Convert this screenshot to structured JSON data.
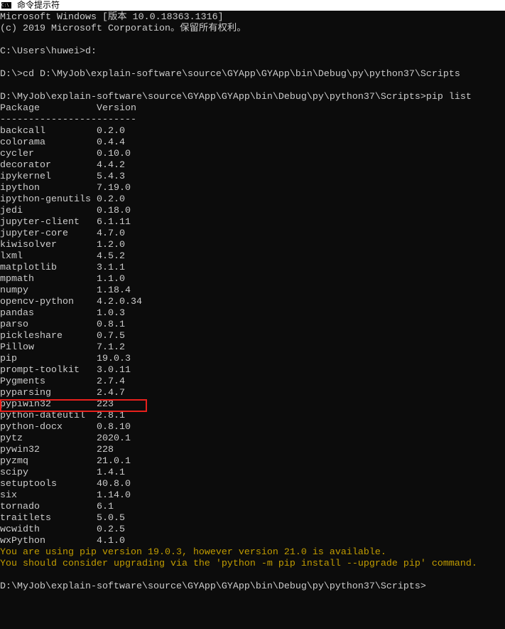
{
  "window": {
    "title": "命令提示符",
    "icon": "cmd-icon",
    "icon_text": "C:\\"
  },
  "header_lines": [
    "Microsoft Windows [版本 10.0.18363.1316]",
    "(c) 2019 Microsoft Corporation。保留所有权利。",
    "",
    "C:\\Users\\huwei>d:",
    "",
    "D:\\>cd D:\\MyJob\\explain-software\\source\\GYApp\\GYApp\\bin\\Debug\\py\\python37\\Scripts",
    "",
    "D:\\MyJob\\explain-software\\source\\GYApp\\GYApp\\bin\\Debug\\py\\python37\\Scripts>pip list"
  ],
  "table": {
    "headers": [
      "Package",
      "Version"
    ],
    "separator": [
      "-----------------",
      "-------"
    ],
    "rows": [
      [
        "backcall",
        "0.2.0"
      ],
      [
        "colorama",
        "0.4.4"
      ],
      [
        "cycler",
        "0.10.0"
      ],
      [
        "decorator",
        "4.4.2"
      ],
      [
        "ipykernel",
        "5.4.3"
      ],
      [
        "ipython",
        "7.19.0"
      ],
      [
        "ipython-genutils",
        "0.2.0"
      ],
      [
        "jedi",
        "0.18.0"
      ],
      [
        "jupyter-client",
        "6.1.11"
      ],
      [
        "jupyter-core",
        "4.7.0"
      ],
      [
        "kiwisolver",
        "1.2.0"
      ],
      [
        "lxml",
        "4.5.2"
      ],
      [
        "matplotlib",
        "3.1.1"
      ],
      [
        "mpmath",
        "1.1.0"
      ],
      [
        "numpy",
        "1.18.4"
      ],
      [
        "opencv-python",
        "4.2.0.34"
      ],
      [
        "pandas",
        "1.0.3"
      ],
      [
        "parso",
        "0.8.1"
      ],
      [
        "pickleshare",
        "0.7.5"
      ],
      [
        "Pillow",
        "7.1.2"
      ],
      [
        "pip",
        "19.0.3"
      ],
      [
        "prompt-toolkit",
        "3.0.11"
      ],
      [
        "Pygments",
        "2.7.4"
      ],
      [
        "pyparsing",
        "2.4.7"
      ],
      [
        "pypiwin32",
        "223"
      ],
      [
        "python-dateutil",
        "2.8.1"
      ],
      [
        "python-docx",
        "0.8.10"
      ],
      [
        "pytz",
        "2020.1"
      ],
      [
        "pywin32",
        "228"
      ],
      [
        "pyzmq",
        "21.0.1"
      ],
      [
        "scipy",
        "1.4.1"
      ],
      [
        "setuptools",
        "40.8.0"
      ],
      [
        "six",
        "1.14.0"
      ],
      [
        "tornado",
        "6.1"
      ],
      [
        "traitlets",
        "5.0.5"
      ],
      [
        "wcwidth",
        "0.2.5"
      ],
      [
        "wxPython",
        "4.1.0"
      ]
    ],
    "highlighted_row": "pypiwin32"
  },
  "warnings": [
    "You are using pip version 19.0.3, however version 21.0 is available.",
    "You should consider upgrading via the 'python -m pip install --upgrade pip' command."
  ],
  "final_prompt": "D:\\MyJob\\explain-software\\source\\GYApp\\GYApp\\bin\\Debug\\py\\python37\\Scripts>",
  "colors": {
    "background": "#0c0c0c",
    "text": "#cccccc",
    "warning": "#c19c00",
    "highlight_box": "#e8201c"
  }
}
